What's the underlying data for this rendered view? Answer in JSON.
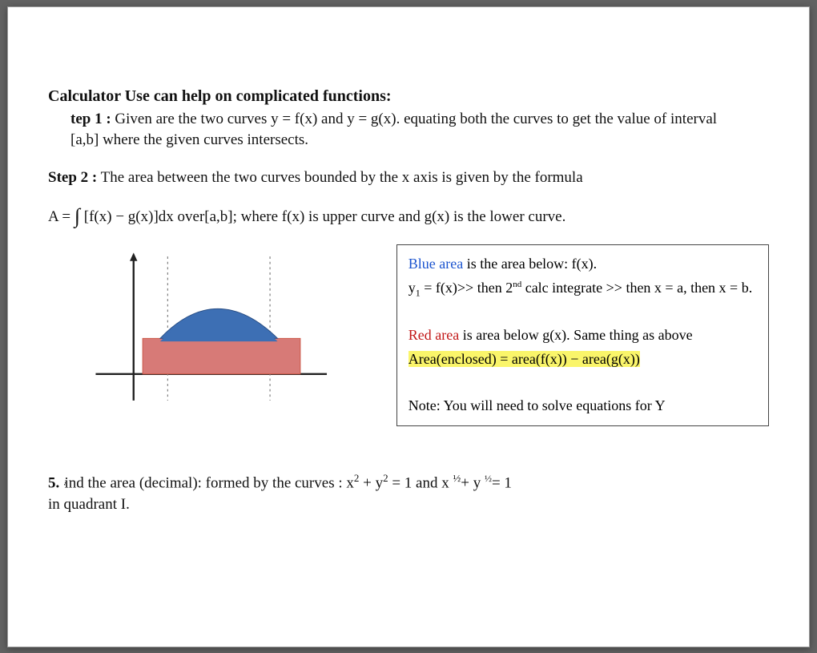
{
  "heading": "Calculator Use can help on complicated functions:",
  "step1": {
    "label": "tep 1 :",
    "text_a": " Given are the two curves y = f(x) and y = g(x). equating both the curves to get the value of interval",
    "text_b": "[a,b] where the given curves intersects."
  },
  "step2": {
    "label": "Step 2 :",
    "text": " The area between the two curves bounded by the x axis is given by the formula"
  },
  "formula": {
    "lhs": "A = ",
    "int": "∫",
    "mid": " [f(x) − g(x)]dx   over[a,b];   where f(x) is upper curve and g(x) is the lower curve."
  },
  "figure": {
    "blue_color": "#3d6fb4",
    "red_color": "#d77a77",
    "axis_color": "#222",
    "dash_color": "#777"
  },
  "infobox": {
    "line1_a": "Blue area",
    "line1_b": " is the area below:  f(x).",
    "line2": "y₁ = f(x)>>  then  2ⁿᵈ calc integrate >>  then x = a, then x = b.",
    "line2_pre": "y",
    "line2_sub": "1",
    "line2_mid": " = f(x)>>  then  2",
    "line2_sup": "nd",
    "line2_post": " calc integrate >>  then x = a, then x = b.",
    "line3_a": "Red area",
    "line3_b": " is area below g(x). Same thing as above",
    "line4": "Area(enclosed) = area(f(x)) − area(g(x))",
    "line5": "Note:  You will need to solve equations for Y"
  },
  "problem": {
    "num": "5.",
    "tiny": "  ",
    "text_a": "ind the area (decimal): formed by the curves :  x",
    "sq": "2",
    "plus1": "  +  y",
    "eq1": "  = 1   and   x ",
    "half1": "½",
    "plus2": "+  y ",
    "half2": "½",
    "eq2": "=  1",
    "text_b": "in quadrant I."
  }
}
